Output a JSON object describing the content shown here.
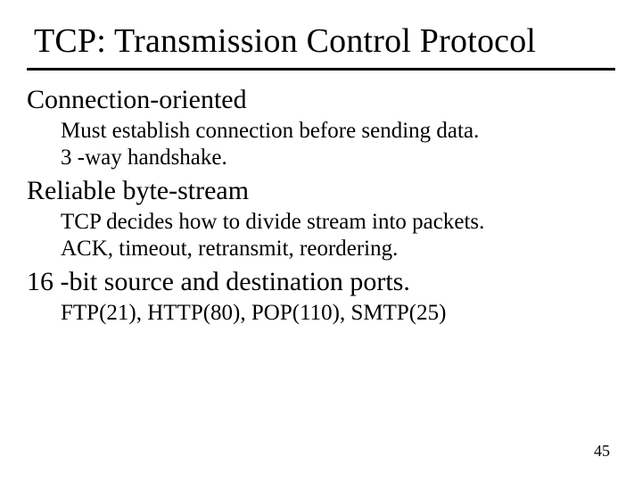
{
  "title": "TCP: Transmission Control Protocol",
  "sections": {
    "s1": {
      "heading": "Connection-oriented",
      "line1": "Must establish connection before sending data.",
      "line2": "3 -way handshake."
    },
    "s2": {
      "heading": "Reliable byte-stream",
      "line1": "TCP decides how to divide stream into packets.",
      "line2": "ACK, timeout, retransmit, reordering."
    },
    "s3": {
      "heading": "16 -bit source and destination ports.",
      "line1": "FTP(21), HTTP(80), POP(110), SMTP(25)"
    }
  },
  "page_number": "45"
}
